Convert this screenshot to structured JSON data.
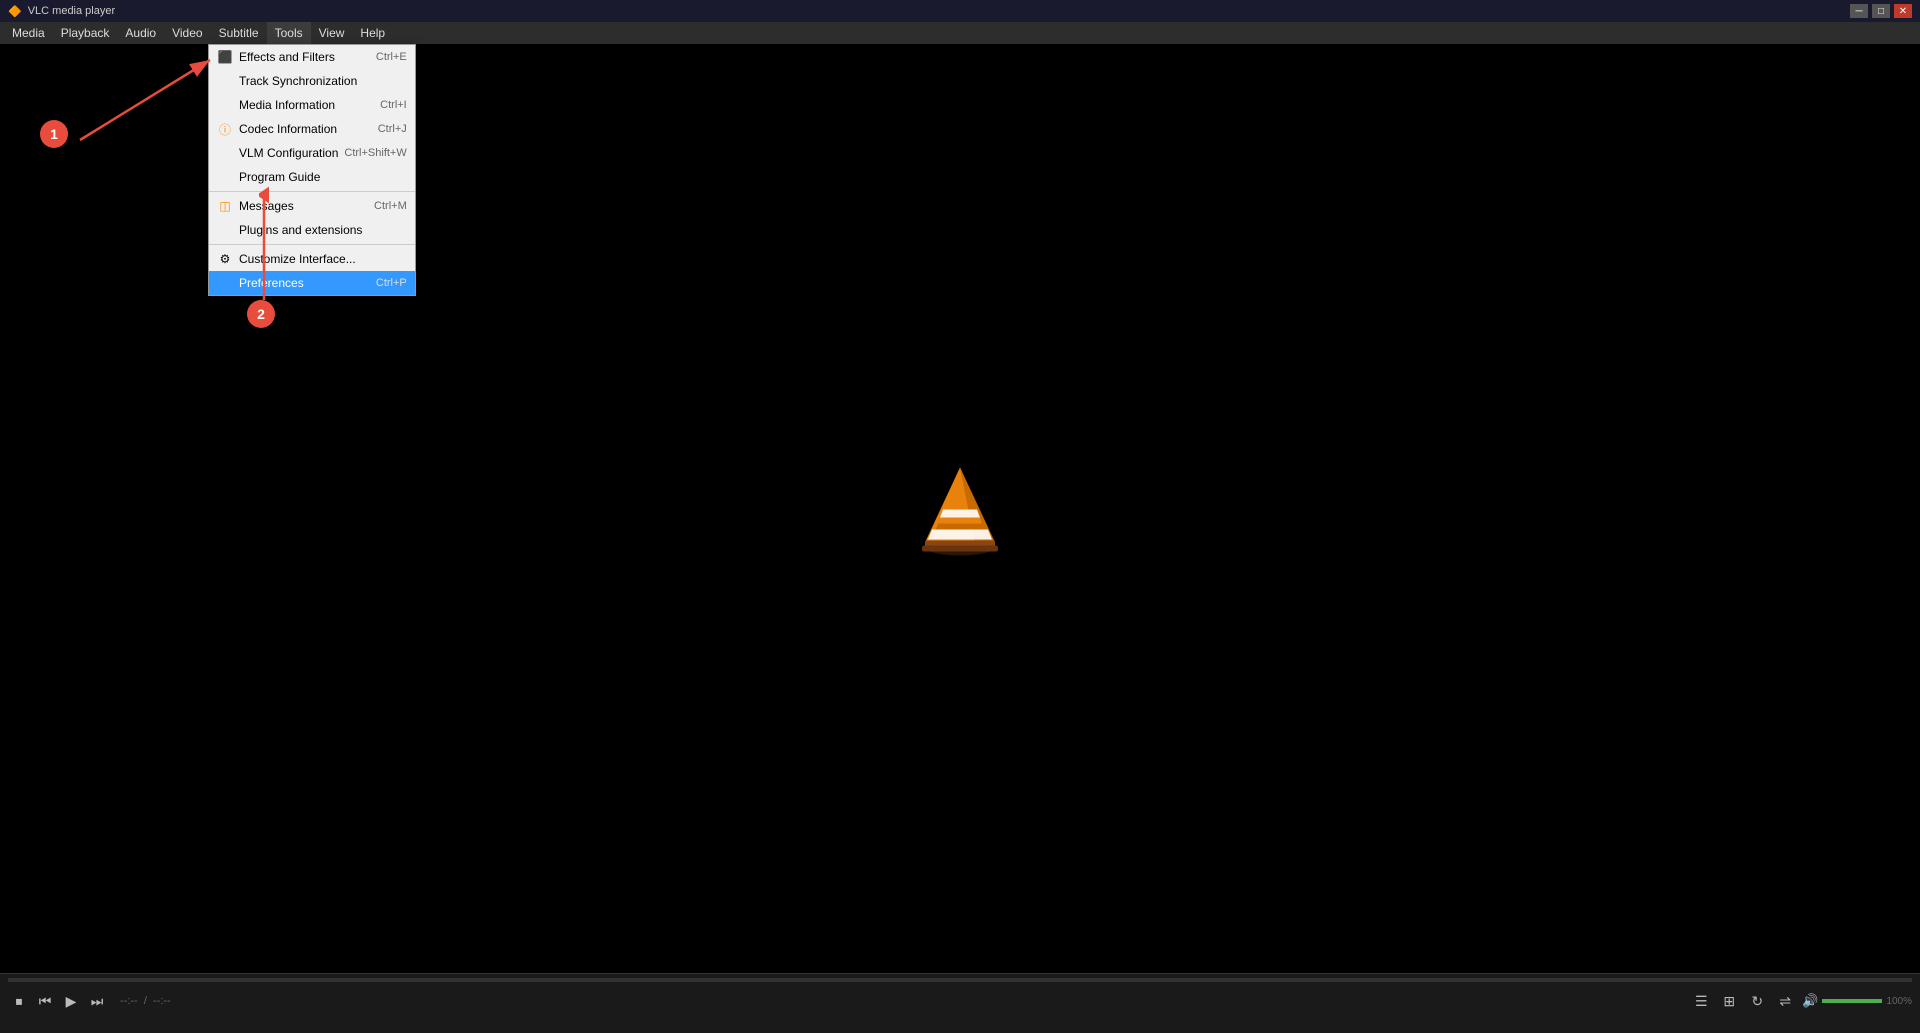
{
  "window": {
    "title": "VLC media player",
    "icon": "🔶"
  },
  "titlebar": {
    "minimize": "─",
    "maximize": "□",
    "close": "✕"
  },
  "menubar": {
    "items": [
      {
        "label": "Media",
        "id": "media"
      },
      {
        "label": "Playback",
        "id": "playback"
      },
      {
        "label": "Audio",
        "id": "audio"
      },
      {
        "label": "Video",
        "id": "video"
      },
      {
        "label": "Subtitle",
        "id": "subtitle"
      },
      {
        "label": "Tools",
        "id": "tools",
        "active": true
      },
      {
        "label": "View",
        "id": "view"
      },
      {
        "label": "Help",
        "id": "help"
      }
    ]
  },
  "tools_menu": {
    "items": [
      {
        "label": "Effects and Filters",
        "shortcut": "Ctrl+E",
        "icon": "sliders",
        "type": "icon-orange"
      },
      {
        "label": "Track Synchronization",
        "shortcut": "",
        "icon": null
      },
      {
        "label": "Media Information",
        "shortcut": "Ctrl+I",
        "icon": null
      },
      {
        "label": "Codec Information",
        "shortcut": "Ctrl+J",
        "icon": "info",
        "type": "icon-orange"
      },
      {
        "label": "VLM Configuration",
        "shortcut": "Ctrl+Shift+W",
        "icon": null
      },
      {
        "label": "Program Guide",
        "shortcut": "",
        "icon": null
      },
      {
        "separator": true
      },
      {
        "label": "Messages",
        "shortcut": "Ctrl+M",
        "icon": "msg",
        "type": "icon-orange"
      },
      {
        "label": "Plugins and extensions",
        "shortcut": "",
        "icon": null
      },
      {
        "separator2": true
      },
      {
        "label": "Customize Interface...",
        "shortcut": "",
        "icon": "gear"
      },
      {
        "label": "Preferences",
        "shortcut": "Ctrl+P",
        "highlighted": true
      }
    ]
  },
  "player": {
    "time_current": "--:--",
    "time_total": "--:--",
    "volume_percent": "100%",
    "progress_percent": 0
  },
  "annotations": {
    "badge1": "1",
    "badge2": "2"
  }
}
